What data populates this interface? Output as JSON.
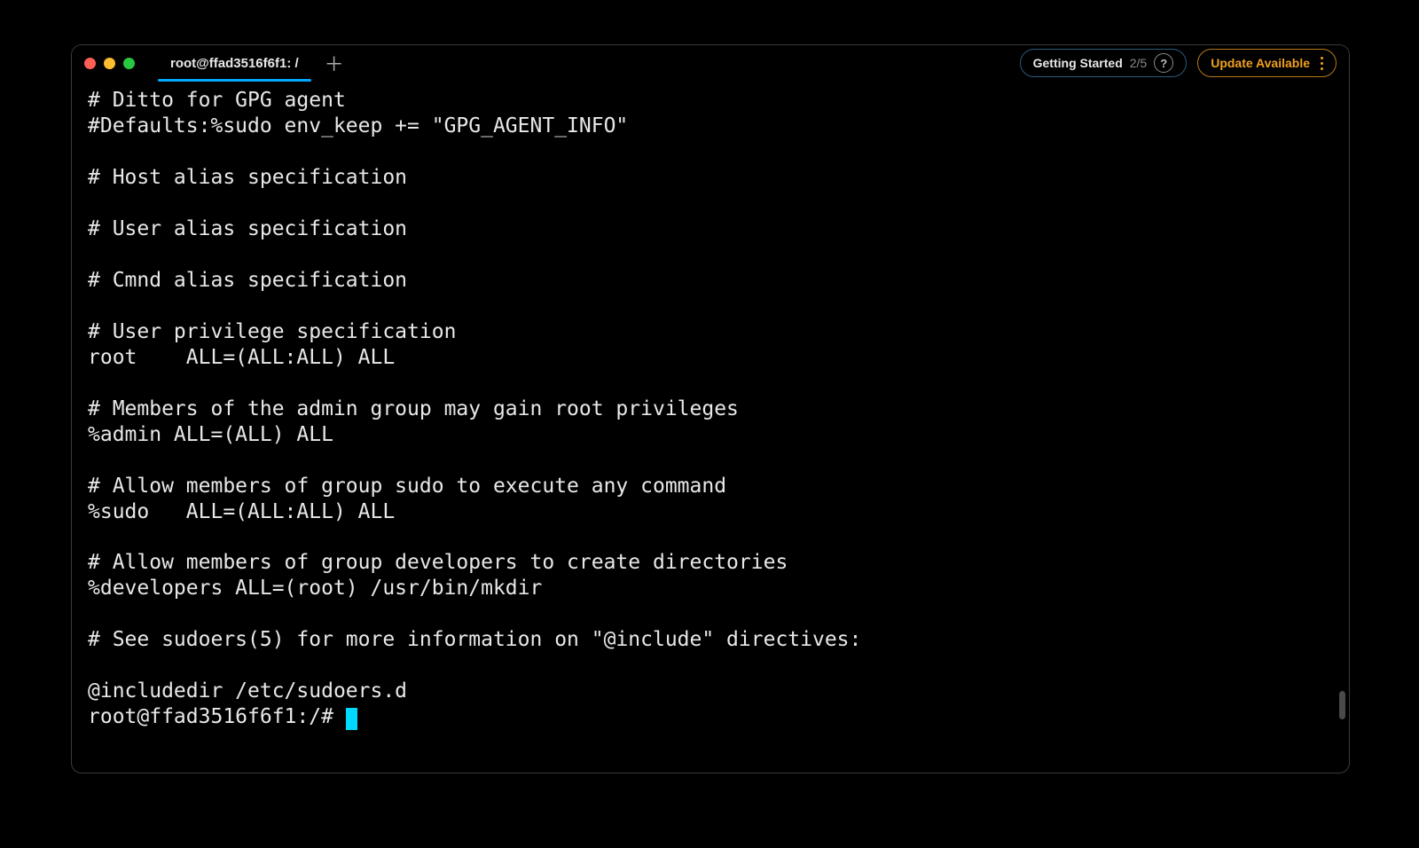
{
  "tab": {
    "title": "root@ffad3516f6f1: /"
  },
  "getting_started": {
    "label": "Getting Started",
    "progress": "2/5"
  },
  "update": {
    "label": "Update Available"
  },
  "terminal": {
    "lines": [
      "# Ditto for GPG agent",
      "#Defaults:%sudo env_keep += \"GPG_AGENT_INFO\"",
      "",
      "# Host alias specification",
      "",
      "# User alias specification",
      "",
      "# Cmnd alias specification",
      "",
      "# User privilege specification",
      "root    ALL=(ALL:ALL) ALL",
      "",
      "# Members of the admin group may gain root privileges",
      "%admin ALL=(ALL) ALL",
      "",
      "# Allow members of group sudo to execute any command",
      "%sudo   ALL=(ALL:ALL) ALL",
      "",
      "# Allow members of group developers to create directories",
      "%developers ALL=(root) /usr/bin/mkdir",
      "",
      "# See sudoers(5) for more information on \"@include\" directives:",
      "",
      "@includedir /etc/sudoers.d"
    ],
    "prompt": "root@ffad3516f6f1:/# "
  }
}
